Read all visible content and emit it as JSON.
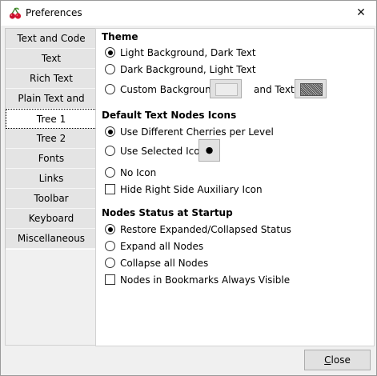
{
  "window": {
    "title": "Preferences",
    "close_glyph": "✕",
    "app_icon": "cherry-icon"
  },
  "sidebar": {
    "items": [
      {
        "label": "Text and Code"
      },
      {
        "label": "Text"
      },
      {
        "label": "Rich Text"
      },
      {
        "label": "Plain Text and Code"
      },
      {
        "label": "Tree 1",
        "selected": true
      },
      {
        "label": "Tree 2"
      },
      {
        "label": "Fonts"
      },
      {
        "label": "Links"
      },
      {
        "label": "Toolbar"
      },
      {
        "label": "Keyboard Shortcuts"
      },
      {
        "label": "Miscellaneous"
      }
    ]
  },
  "theme": {
    "heading": "Theme",
    "options": [
      {
        "label": "Light Background, Dark Text",
        "selected": true
      },
      {
        "label": "Dark Background, Light Text",
        "selected": false
      },
      {
        "label": "Custom Background",
        "selected": false
      }
    ],
    "and_text_label": "and Text"
  },
  "icons_section": {
    "heading": "Default Text Nodes Icons",
    "options": [
      {
        "label": "Use Different Cherries per Level",
        "selected": true
      },
      {
        "label": "Use Selected Icon",
        "selected": false
      },
      {
        "label": "No Icon",
        "selected": false
      }
    ],
    "selected_icon_glyph": "●",
    "hide_aux_label": "Hide Right Side Auxiliary Icon",
    "hide_aux_checked": false
  },
  "status_section": {
    "heading": "Nodes Status at Startup",
    "options": [
      {
        "label": "Restore Expanded/Collapsed Status",
        "selected": true
      },
      {
        "label": "Expand all Nodes",
        "selected": false
      },
      {
        "label": "Collapse all Nodes",
        "selected": false
      }
    ],
    "bookmarks_label": "Nodes in Bookmarks Always Visible",
    "bookmarks_checked": false
  },
  "footer": {
    "close_mnemonic": "C",
    "close_rest": "lose"
  },
  "colors": {
    "sidebar_item_bg": "#e4e4e4",
    "content_bg": "#ffffff",
    "window_bg": "#f0f0f0"
  }
}
